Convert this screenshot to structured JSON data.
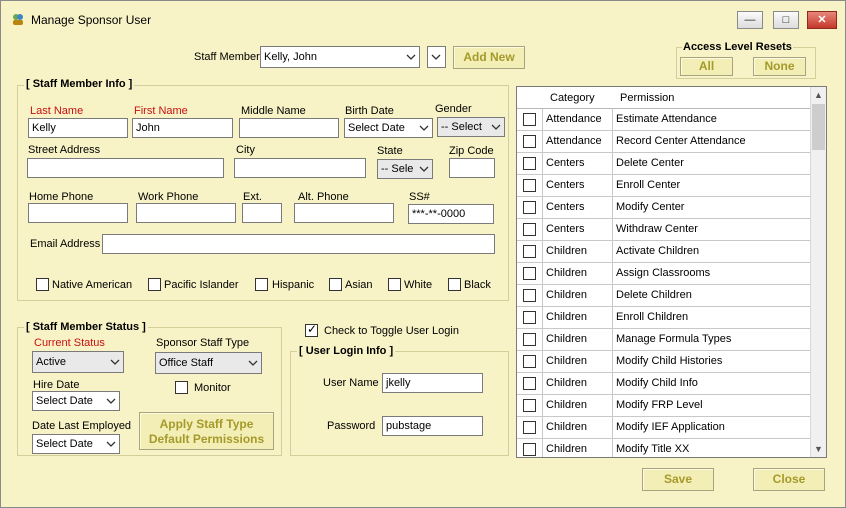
{
  "window": {
    "title": "Manage Sponsor User",
    "minimize_label": "—",
    "maximize_label": "□",
    "close_label": "✕"
  },
  "top": {
    "staff_member_label": "Staff Member",
    "staff_member_value": "Kelly, John",
    "add_new_label": "Add New"
  },
  "access_resets": {
    "title": "Access Level Resets",
    "all_label": "All",
    "none_label": "None"
  },
  "info": {
    "title": "[ Staff Member Info ]",
    "last_name_label": "Last Name",
    "last_name_value": "Kelly",
    "first_name_label": "First Name",
    "first_name_value": "John",
    "middle_name_label": "Middle Name",
    "middle_name_value": "",
    "birth_date_label": "Birth Date",
    "birth_date_value": "Select Date",
    "gender_label": "Gender",
    "gender_value": "-- Select",
    "street_label": "Street Address",
    "city_label": "City",
    "state_label": "State",
    "state_value": "-- Sele",
    "zip_label": "Zip Code",
    "home_phone_label": "Home Phone",
    "work_phone_label": "Work Phone",
    "ext_label": "Ext.",
    "alt_phone_label": "Alt. Phone",
    "ssn_label": "SS#",
    "ssn_value": "***-**-0000",
    "email_label": "Email Address",
    "ethnicities": [
      "Native American",
      "Pacific Islander",
      "Hispanic",
      "Asian",
      "White",
      "Black"
    ]
  },
  "status": {
    "title": "[ Staff Member Status ]",
    "current_status_label": "Current Status",
    "current_status_value": "Active",
    "staff_type_label": "Sponsor Staff Type",
    "staff_type_value": "Office Staff",
    "hire_date_label": "Hire Date",
    "hire_date_value": "Select Date",
    "monitor_label": "Monitor",
    "last_employed_label": "Date Last Employed",
    "last_employed_value": "Select Date",
    "apply_label_line1": "Apply Staff Type",
    "apply_label_line2": "Default Permissions"
  },
  "login": {
    "toggle_label": "Check to Toggle User Login",
    "title": "[ User Login Info ]",
    "username_label": "User Name",
    "username_value": "jkelly",
    "password_label": "Password",
    "password_value": "pubstage"
  },
  "permissions": {
    "headers": [
      "Category",
      "Permission"
    ],
    "rows": [
      {
        "category": "Attendance",
        "permission": "Estimate Attendance"
      },
      {
        "category": "Attendance",
        "permission": "Record Center Attendance"
      },
      {
        "category": "Centers",
        "permission": "Delete Center"
      },
      {
        "category": "Centers",
        "permission": "Enroll Center"
      },
      {
        "category": "Centers",
        "permission": "Modify Center"
      },
      {
        "category": "Centers",
        "permission": "Withdraw Center"
      },
      {
        "category": "Children",
        "permission": "Activate Children"
      },
      {
        "category": "Children",
        "permission": "Assign Classrooms"
      },
      {
        "category": "Children",
        "permission": "Delete Children"
      },
      {
        "category": "Children",
        "permission": "Enroll Children"
      },
      {
        "category": "Children",
        "permission": "Manage Formula Types"
      },
      {
        "category": "Children",
        "permission": "Modify Child Histories"
      },
      {
        "category": "Children",
        "permission": "Modify Child Info"
      },
      {
        "category": "Children",
        "permission": "Modify FRP Level"
      },
      {
        "category": "Children",
        "permission": "Modify IEF Application"
      },
      {
        "category": "Children",
        "permission": "Modify Title XX"
      }
    ]
  },
  "footer": {
    "save_label": "Save",
    "close_label": "Close"
  }
}
